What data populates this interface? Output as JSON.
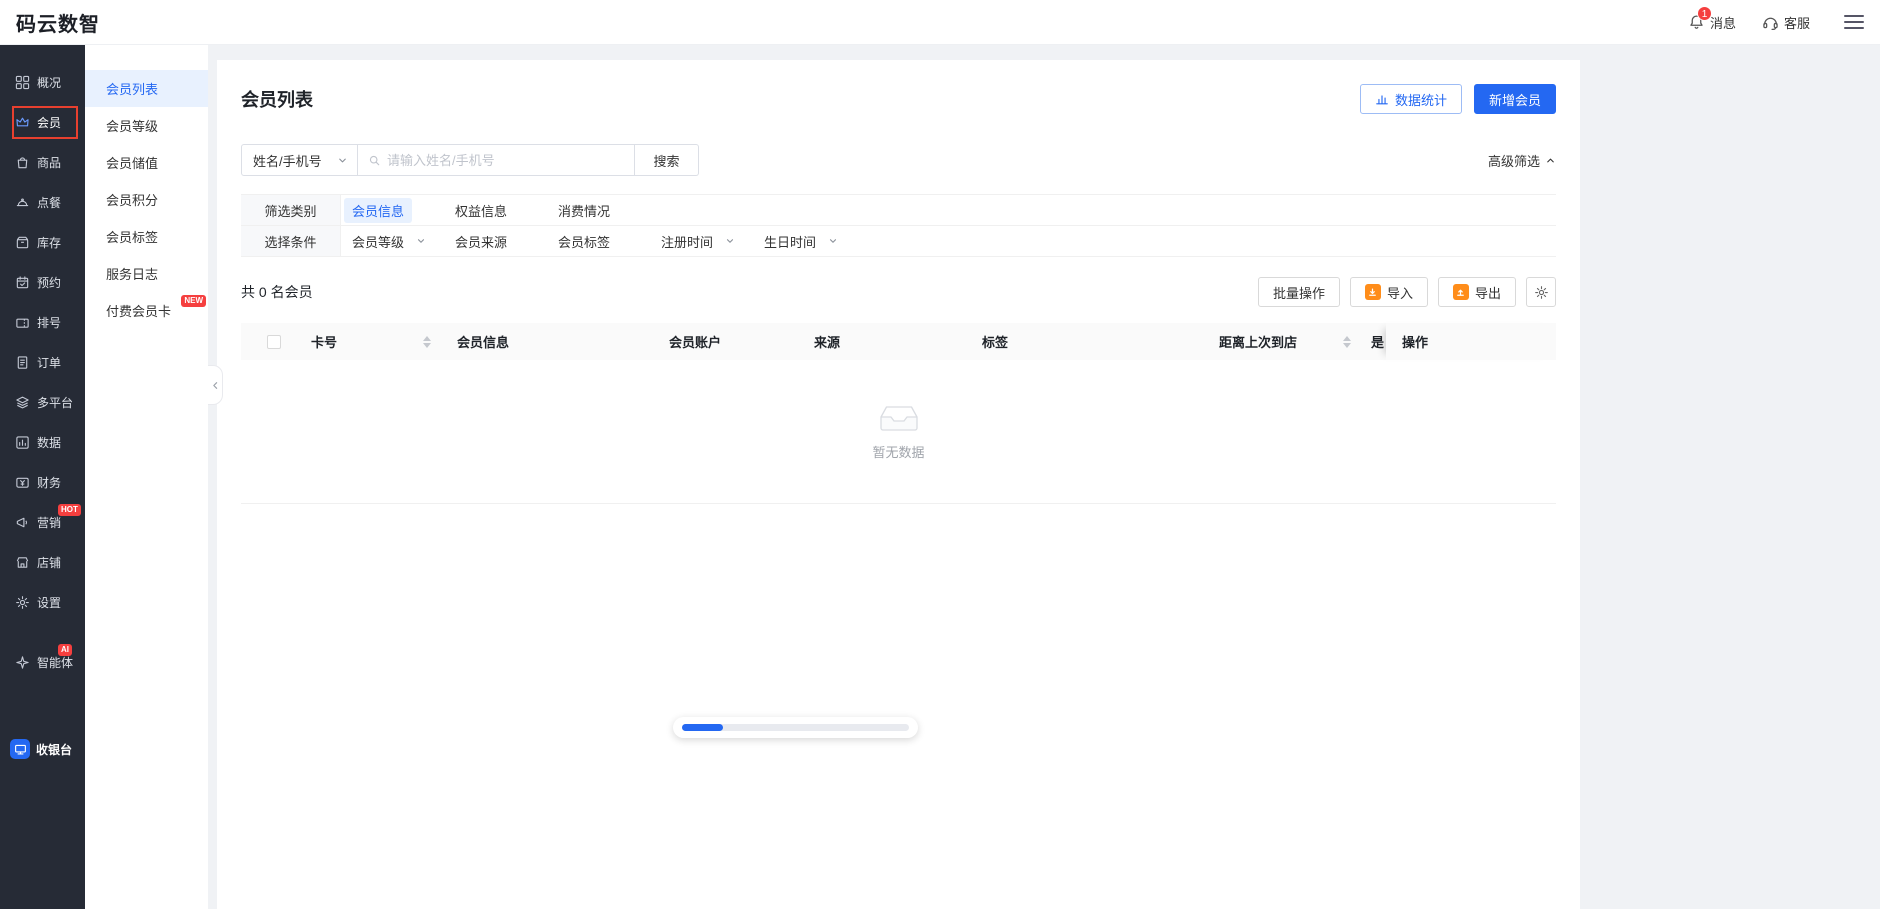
{
  "topbar": {
    "logo": "码云数智",
    "badge_count": "1",
    "messages_label": "消息",
    "support_label": "客服"
  },
  "sidebar": {
    "items": [
      {
        "label": "概况"
      },
      {
        "label": "会员"
      },
      {
        "label": "商品"
      },
      {
        "label": "点餐"
      },
      {
        "label": "库存"
      },
      {
        "label": "预约"
      },
      {
        "label": "排号"
      },
      {
        "label": "订单"
      },
      {
        "label": "多平台"
      },
      {
        "label": "数据"
      },
      {
        "label": "财务"
      },
      {
        "label": "营销",
        "badge": "HOT"
      },
      {
        "label": "店铺"
      },
      {
        "label": "设置"
      },
      {
        "label": "智能体",
        "badge": "AI"
      }
    ],
    "cashier_label": "收银台"
  },
  "submenu": {
    "items": [
      {
        "label": "会员列表"
      },
      {
        "label": "会员等级"
      },
      {
        "label": "会员储值"
      },
      {
        "label": "会员积分"
      },
      {
        "label": "会员标签"
      },
      {
        "label": "服务日志"
      },
      {
        "label": "付费会员卡",
        "badge": "NEW"
      }
    ]
  },
  "page": {
    "title": "会员列表",
    "stats_button": "数据统计",
    "add_button": "新增会员",
    "search_field": "姓名/手机号",
    "search_placeholder": "请输入姓名/手机号",
    "search_button": "搜索",
    "advanced_filter": "高级筛选",
    "filters": {
      "category_label": "筛选类别",
      "categories": [
        "会员信息",
        "权益信息",
        "消费情况"
      ],
      "condition_label": "选择条件",
      "conditions": [
        "会员等级",
        "会员来源",
        "会员标签",
        "注册时间",
        "生日时间"
      ]
    },
    "count_text": "共 0 名会员",
    "batch_button": "批量操作",
    "import_button": "导入",
    "export_button": "导出",
    "table": {
      "col_card_no": "卡号",
      "col_member_info": "会员信息",
      "col_member_account": "会员账户",
      "col_source": "来源",
      "col_tags": "标签",
      "col_last_visit": "距离上次到店",
      "col_cutoff": "是",
      "col_actions": "操作",
      "empty_text": "暂无数据"
    },
    "colors": {
      "accent_blue": "#2468f2",
      "icon_orange": "#ff8d1a",
      "badge_red": "#f53f3f",
      "sidebar_dark": "#262b36",
      "annotation_red": "#e8402f"
    }
  }
}
